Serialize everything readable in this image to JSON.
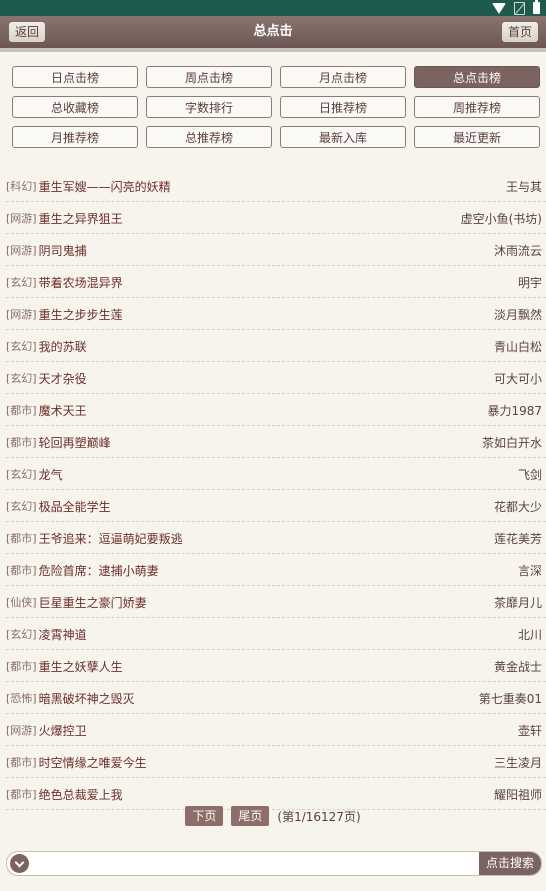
{
  "header": {
    "back": "返回",
    "title": "总点击",
    "home": "首页"
  },
  "tabs": [
    {
      "label": "日点击榜"
    },
    {
      "label": "周点击榜"
    },
    {
      "label": "月点击榜"
    },
    {
      "label": "总点击榜",
      "active": true
    },
    {
      "label": "总收藏榜"
    },
    {
      "label": "字数排行"
    },
    {
      "label": "日推荐榜"
    },
    {
      "label": "周推荐榜"
    },
    {
      "label": "月推荐榜"
    },
    {
      "label": "总推荐榜"
    },
    {
      "label": "最新入库"
    },
    {
      "label": "最近更新"
    }
  ],
  "books": [
    {
      "cat": "[科幻]",
      "title": "重生军嫂——闪亮的妖精",
      "author": "王与其"
    },
    {
      "cat": "[网游]",
      "title": "重生之异界狙王",
      "author": "虚空小鱼(书坊)"
    },
    {
      "cat": "[网游]",
      "title": "阴司鬼捕",
      "author": "沐雨流云"
    },
    {
      "cat": "[玄幻]",
      "title": "带着农场混异界",
      "author": "明宇"
    },
    {
      "cat": "[网游]",
      "title": "重生之步步生莲",
      "author": "淡月飘然"
    },
    {
      "cat": "[玄幻]",
      "title": "我的苏联",
      "author": "青山白松"
    },
    {
      "cat": "[玄幻]",
      "title": "天才杂役",
      "author": "可大可小"
    },
    {
      "cat": "[都市]",
      "title": "魔术天王",
      "author": "暴力1987"
    },
    {
      "cat": "[都市]",
      "title": "轮回再塑巅峰",
      "author": "茶如白开水"
    },
    {
      "cat": "[玄幻]",
      "title": "龙气",
      "author": "飞剑"
    },
    {
      "cat": "[玄幻]",
      "title": "极品全能学生",
      "author": "花都大少"
    },
    {
      "cat": "[都市]",
      "title": "王爷追来：逗逼萌妃要叛逃",
      "author": "莲花美芳"
    },
    {
      "cat": "[都市]",
      "title": "危险首席：逮捕小萌妻",
      "author": "言深"
    },
    {
      "cat": "[仙侠]",
      "title": "巨星重生之豪门娇妻",
      "author": "茶靡月儿"
    },
    {
      "cat": "[玄幻]",
      "title": "凌霄神道",
      "author": "北川"
    },
    {
      "cat": "[都市]",
      "title": "重生之妖孽人生",
      "author": "黄金战士"
    },
    {
      "cat": "[恐怖]",
      "title": "暗黑破坏神之毁灭",
      "author": "第七重奏01"
    },
    {
      "cat": "[网游]",
      "title": "火爆控卫",
      "author": "壶轩"
    },
    {
      "cat": "[都市]",
      "title": "时空情缘之唯爱今生",
      "author": "三生凌月"
    },
    {
      "cat": "[都市]",
      "title": "绝色总裁爱上我",
      "author": "耀阳祖师"
    }
  ],
  "pager": {
    "next": "下页",
    "last": "尾页",
    "info": "(第1/16127页)"
  },
  "search": {
    "placeholder": "",
    "button": "点击搜索"
  },
  "colors": {
    "status_bar": "#1f5a4e",
    "header": "#7b6460",
    "title_text": "#6b2f2a"
  }
}
